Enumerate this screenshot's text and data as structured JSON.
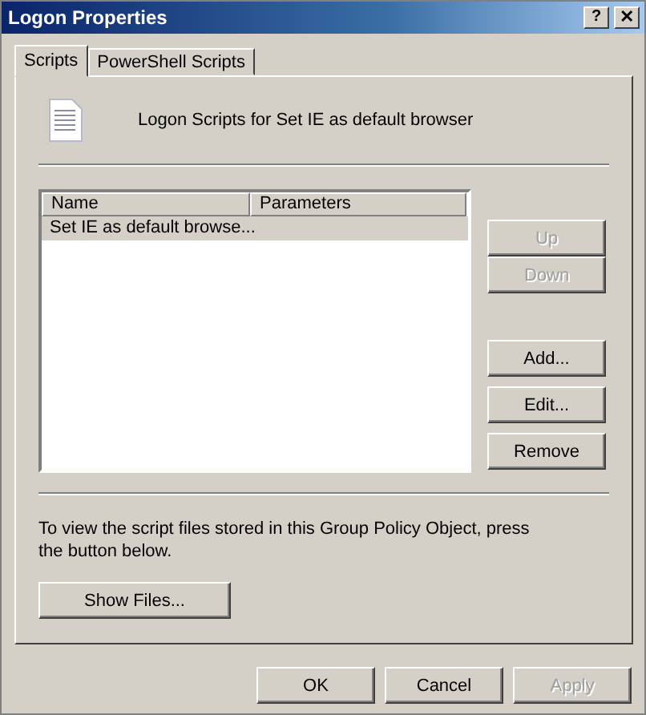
{
  "window": {
    "title": "Logon Properties",
    "controls": [
      {
        "kind": "help",
        "label": "?"
      },
      {
        "kind": "close",
        "label": "✕"
      }
    ]
  },
  "tabs": [
    {
      "label": "Scripts",
      "selected": true
    },
    {
      "label": "PowerShell Scripts",
      "selected": false
    }
  ],
  "heading": "Logon Scripts for Set IE as default browser",
  "table": {
    "columns": [
      "Name",
      "Parameters"
    ],
    "rows": [
      {
        "cells": [
          "Set IE as default browse...",
          ""
        ],
        "selected": true
      }
    ]
  },
  "side_button_groups": [
    [
      {
        "label": "Up",
        "disabled": true
      },
      {
        "label": "Down",
        "disabled": true
      }
    ],
    [
      {
        "label": "Add...",
        "disabled": false
      },
      {
        "label": "Edit...",
        "disabled": false
      },
      {
        "label": "Remove",
        "disabled": false
      }
    ]
  ],
  "info": "To view the script files stored in this Group Policy Object, press the button below.",
  "show_files": {
    "label": "Show Files..."
  },
  "dialog_buttons": [
    {
      "label": "OK",
      "disabled": false
    },
    {
      "label": "Cancel",
      "disabled": false
    },
    {
      "label": "Apply",
      "disabled": true
    }
  ]
}
